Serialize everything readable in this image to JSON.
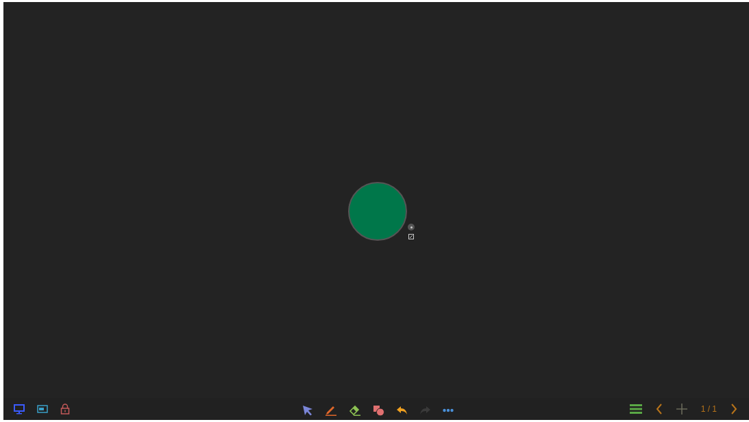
{
  "canvas": {
    "shapes": [
      {
        "kind": "circle"
      }
    ]
  },
  "left_tools": [
    {
      "kind": "screen"
    },
    {
      "kind": "window"
    },
    {
      "kind": "lock"
    }
  ],
  "center_tools": [
    {
      "kind": "select",
      "disabled": false
    },
    {
      "kind": "pen",
      "disabled": false
    },
    {
      "kind": "eraser",
      "disabled": false
    },
    {
      "kind": "shapes",
      "disabled": false
    },
    {
      "kind": "undo",
      "disabled": false
    },
    {
      "kind": "redo",
      "disabled": true
    },
    {
      "kind": "more",
      "disabled": false
    }
  ],
  "pager": {
    "page": "1 / 1"
  }
}
